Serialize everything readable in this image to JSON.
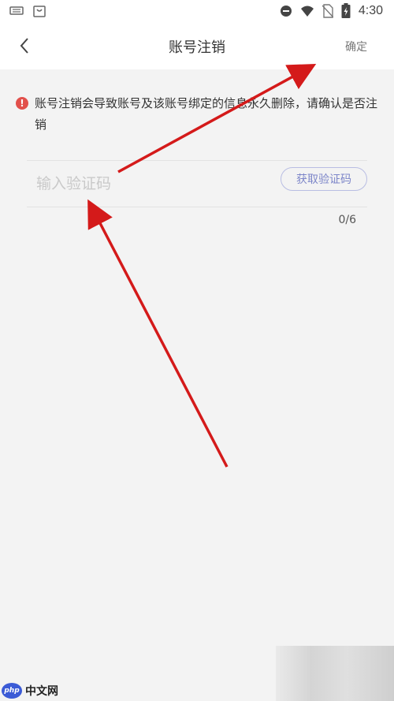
{
  "status_bar": {
    "time": "4:30",
    "icons": [
      "keyboard-icon",
      "bag-icon",
      "dnd-icon",
      "wifi-icon",
      "no-sim-icon",
      "battery-icon"
    ]
  },
  "header": {
    "title": "账号注销",
    "confirm_label": "确定",
    "back_icon": "chevron-left-icon"
  },
  "warning": {
    "icon": "!",
    "text": "账号注销会导致账号及该账号绑定的信息永久删除，请确认是否注销"
  },
  "code_field": {
    "placeholder": "输入验证码",
    "value": "",
    "get_code_label": "获取验证码",
    "counter": "0/6"
  },
  "watermark": {
    "logo": "php",
    "text": "中文网"
  },
  "colors": {
    "accent": "#7d86c9",
    "warning": "#e2504b",
    "arrow": "#d41a1a",
    "background": "#f3f3f3"
  }
}
